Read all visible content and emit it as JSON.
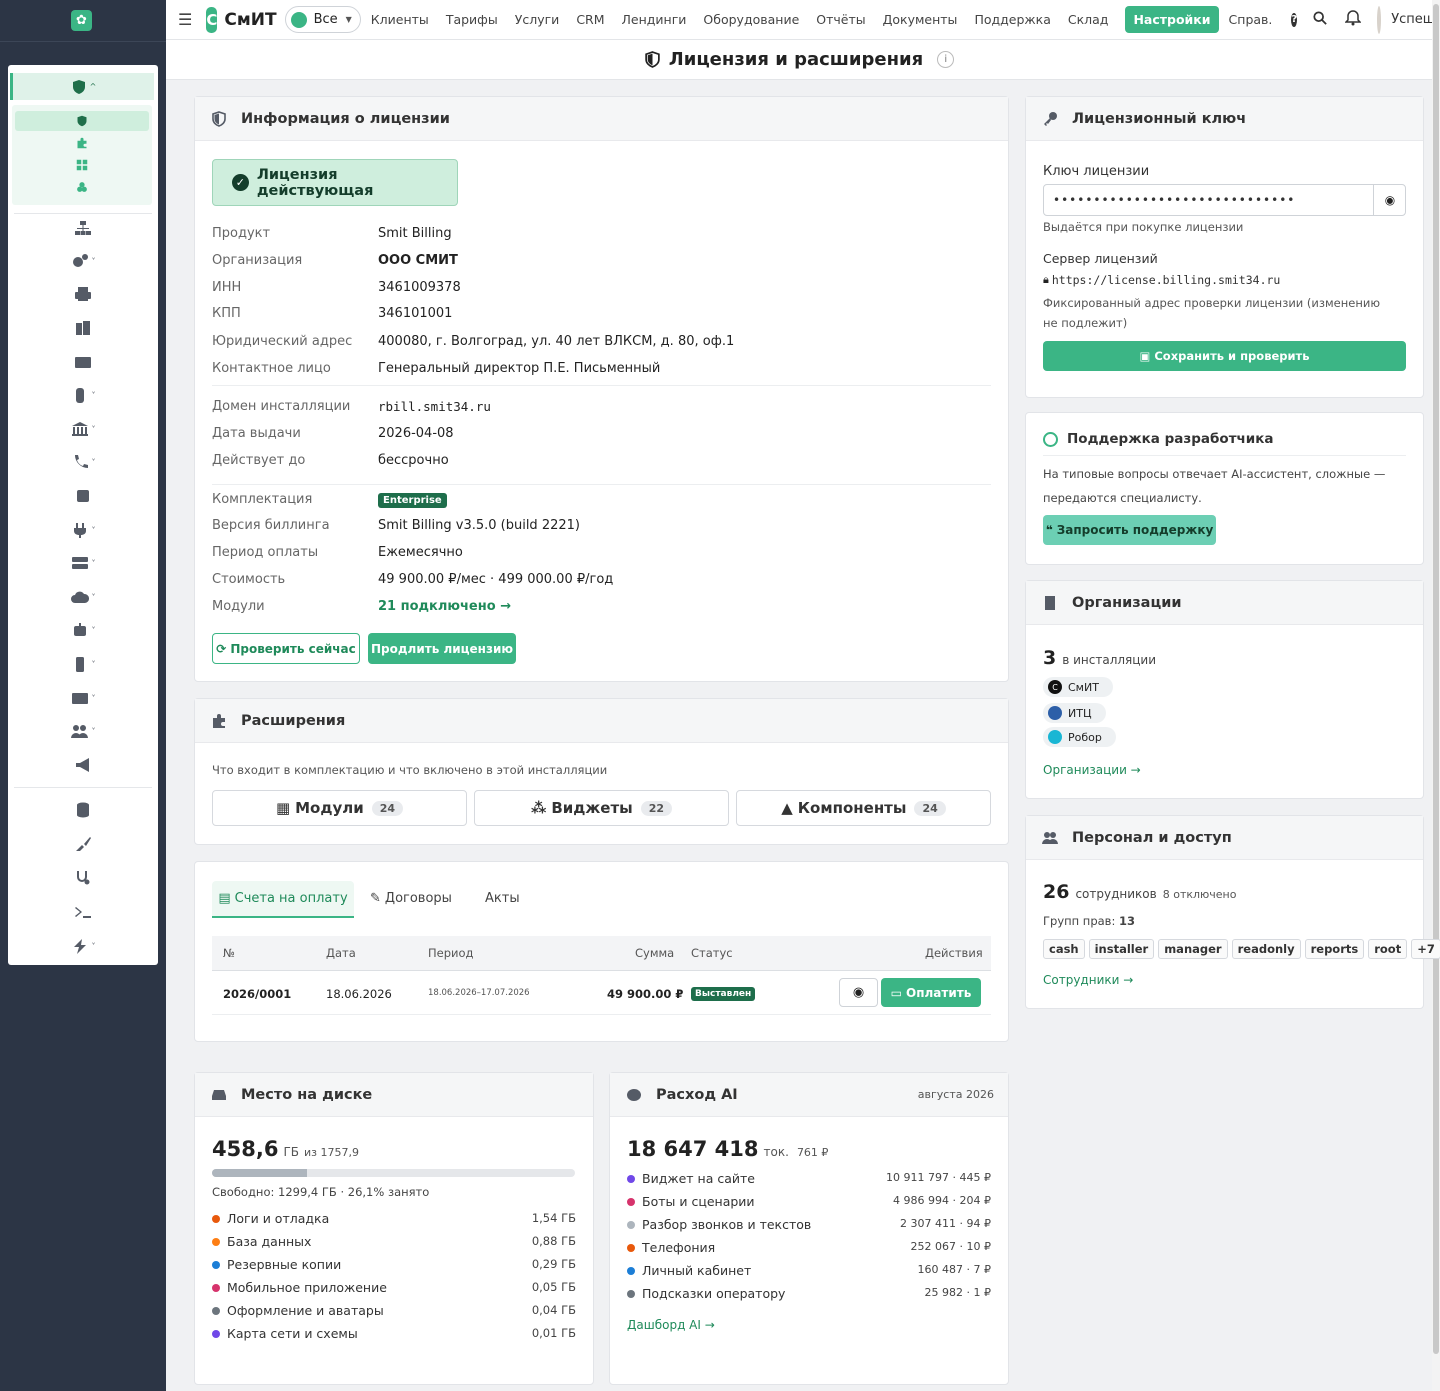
{
  "topbar": {
    "brand_letter": "С",
    "brand_name": "СмИТ",
    "org_select": "Все",
    "nav": [
      "Клиенты",
      "Тарифы",
      "Услуги",
      "CRM",
      "Лендинги",
      "Оборудование",
      "Отчёты",
      "Документы",
      "Поддержка",
      "Склад",
      "Настройки",
      "Справ."
    ],
    "active_nav": "Настройки",
    "user_name": "Успешный"
  },
  "page_title": "Лицензия и расширения",
  "license_info": {
    "header": "Информация о лицензии",
    "status": "Лицензия действующая",
    "rows": [
      {
        "label": "Продукт",
        "value": "Smit Billing"
      },
      {
        "label": "Организация",
        "value": "ООО СМИТ"
      },
      {
        "label": "ИНН",
        "value": "3461009378"
      },
      {
        "label": "КПП",
        "value": "346101001"
      },
      {
        "label": "Юридический адрес",
        "value": "400080, г. Волгоград, ул. 40 лет ВЛКСМ, д. 80, оф.1"
      },
      {
        "label": "Контактное лицо",
        "value": "Генеральный директор П.Е. Письменный"
      }
    ],
    "rows2": [
      {
        "label": "Домен инсталляции",
        "value": "rbill.smit34.ru"
      },
      {
        "label": "Дата выдачи",
        "value": "2026-04-08"
      },
      {
        "label": "Действует до",
        "value": "бессрочно"
      }
    ],
    "edition_label": "Комплектация",
    "edition_badge": "Enterprise",
    "rows3": [
      {
        "label": "Версия биллинга",
        "value": "Smit Billing v3.5.0 (build 2221)"
      },
      {
        "label": "Период оплаты",
        "value": "Ежемесячно"
      },
      {
        "label": "Стоимость",
        "value": "49 900.00 ₽/мес · 499 000.00 ₽/год"
      }
    ],
    "modules_label": "Модули",
    "modules_link": "21 подключено →",
    "check_button": "Проверить сейчас",
    "renew_button": "Продлить лицензию"
  },
  "extensions": {
    "header": "Расширения",
    "description": "Что входит в комплектацию и что включено в этой инсталляции",
    "items": [
      {
        "label": "Модули",
        "count": "24"
      },
      {
        "label": "Виджеты",
        "count": "22"
      },
      {
        "label": "Компоненты",
        "count": "24"
      }
    ]
  },
  "billing": {
    "tabs": [
      "Счета на оплату",
      "Договоры",
      "Акты"
    ],
    "columns": [
      "№",
      "Дата",
      "Период",
      "Сумма",
      "Статус",
      "Действия"
    ],
    "rows": [
      {
        "num": "2026/0001",
        "date": "18.06.2026",
        "period": "18.06.2026–17.07.2026",
        "sum": "49 900.00 ₽",
        "status": "Выставлен",
        "pay": "Оплатить"
      }
    ]
  },
  "disk": {
    "header": "Место на диске",
    "used": "458,6",
    "unit": "ГБ",
    "of": "из 1757,9",
    "used_fraction": 0.261,
    "free": "Свободно: 1299,4 ГБ · 26,1% занято",
    "items": [
      {
        "label": "Логи и отладка",
        "value": "1,54 ГБ",
        "color": "#e8590c"
      },
      {
        "label": "База данных",
        "value": "0,88 ГБ",
        "color": "#fd7e14"
      },
      {
        "label": "Резервные копии",
        "value": "0,29 ГБ",
        "color": "#1c7ed6"
      },
      {
        "label": "Мобильное приложение",
        "value": "0,05 ГБ",
        "color": "#d6336c"
      },
      {
        "label": "Оформление и аватары",
        "value": "0,04 ГБ",
        "color": "#6c757d"
      },
      {
        "label": "Карта сети и схемы",
        "value": "0,01 ГБ",
        "color": "#7048e8"
      }
    ]
  },
  "ai": {
    "header": "Расход AI",
    "month": "августа 2026",
    "total": "18 647 418",
    "unit": "ток.",
    "cost": "761 ₽",
    "items": [
      {
        "label": "Виджет на сайте",
        "value": "10 911 797 · 445 ₽",
        "color": "#7048e8"
      },
      {
        "label": "Боты и сценарии",
        "value": "4 986 994 · 204 ₽",
        "color": "#d6336c"
      },
      {
        "label": "Разбор звонков и текстов",
        "value": "2 307 411 · 94 ₽",
        "color": "#adb5bd"
      },
      {
        "label": "Телефония",
        "value": "252 067 · 10 ₽",
        "color": "#e8590c"
      },
      {
        "label": "Личный кабинет",
        "value": "160 487 · 7 ₽",
        "color": "#1c7ed6"
      },
      {
        "label": "Подсказки оператору",
        "value": "25 982 · 1 ₽",
        "color": "#6c757d"
      }
    ],
    "link": "Дашборд AI →"
  },
  "license_key": {
    "header": "Лицензионный ключ",
    "key_label": "Ключ лицензии",
    "key_value": "••••••••••••••••••••••••••••••",
    "key_hint": "Выдаётся при покупке лицензии",
    "server_label": "Сервер лицензий",
    "server_url": "https://license.billing.smit34.ru",
    "server_hint": "Фиксированный адрес проверки лицензии (изменению не подлежит)",
    "save_button": "Сохранить и проверить"
  },
  "support": {
    "header": "Поддержка разработчика",
    "text": "На типовые вопросы отвечает AI-ассистент, сложные — передаются специалисту.",
    "button": "Запросить поддержку"
  },
  "orgs": {
    "header": "Организации",
    "count": "3",
    "count_label": "в инсталляции",
    "items": [
      "СмИТ",
      "ИТЦ",
      "Робор"
    ],
    "link": "Организации →"
  },
  "staff": {
    "header": "Персонал и доступ",
    "count": "26",
    "count_label": "сотрудников",
    "disabled": "8 отключено",
    "groups_label": "Групп прав:",
    "groups_count": "13",
    "tags": [
      "cash",
      "installer",
      "manager",
      "readonly",
      "reports",
      "root",
      "+7"
    ],
    "link": "Сотрудники →"
  }
}
